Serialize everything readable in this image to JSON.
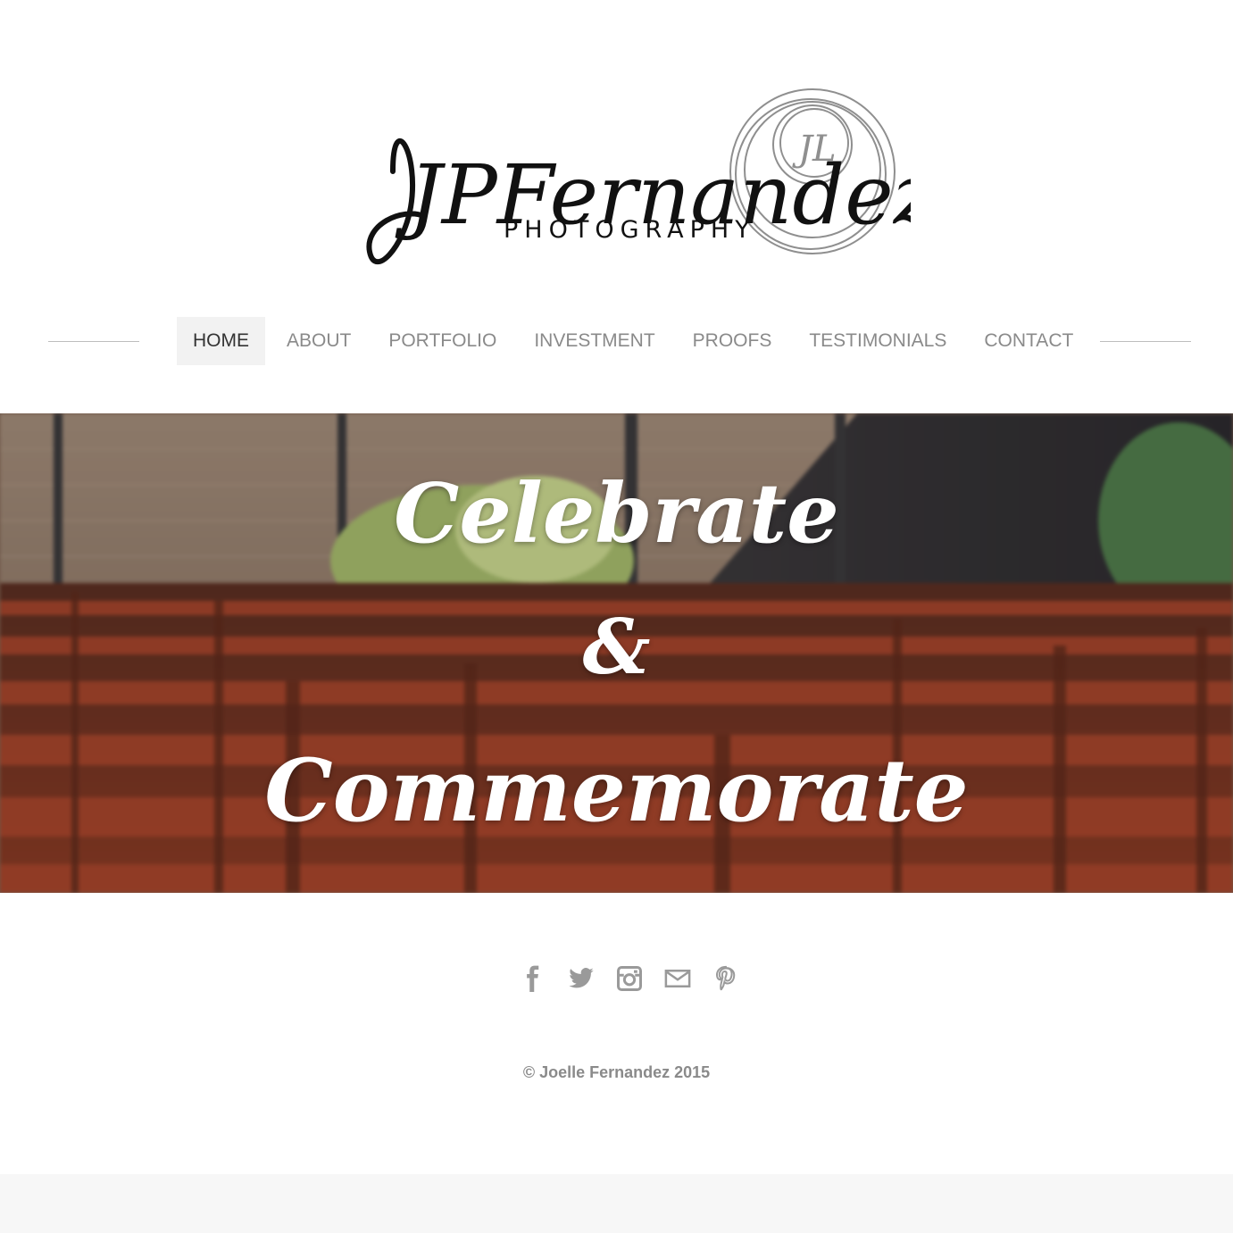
{
  "logo": {
    "script_text": "JPFernandez",
    "sub_text": "PHOTOGRAPHY",
    "monogram": "JL"
  },
  "nav": {
    "items": [
      {
        "label": "HOME",
        "active": true
      },
      {
        "label": "ABOUT",
        "active": false
      },
      {
        "label": "PORTFOLIO",
        "active": false
      },
      {
        "label": "INVESTMENT",
        "active": false
      },
      {
        "label": "PROOFS",
        "active": false
      },
      {
        "label": "TESTIMONIALS",
        "active": false
      },
      {
        "label": "CONTACT",
        "active": false
      }
    ]
  },
  "hero": {
    "line1": "Celebrate",
    "line2": "&",
    "line3": "Commemorate"
  },
  "social": {
    "icons": [
      "facebook-icon",
      "twitter-icon",
      "instagram-icon",
      "mail-icon",
      "pinterest-icon"
    ],
    "color": "#9a9a9a"
  },
  "footer": {
    "copyright": "© Joelle Fernandez 2015"
  },
  "colors": {
    "nav_text": "#8a8a8a",
    "nav_active_bg": "#f2f2f2",
    "footer_band": "#f7f7f7"
  }
}
